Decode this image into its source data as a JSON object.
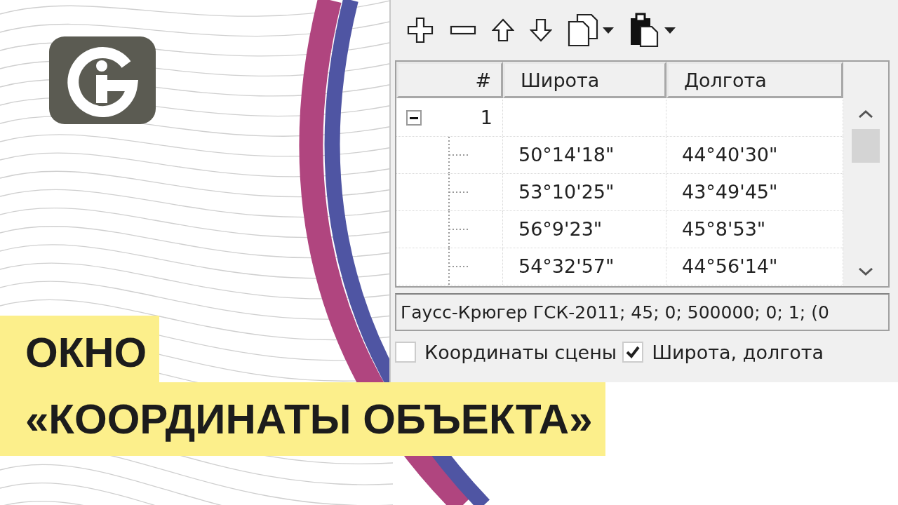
{
  "table": {
    "columns": [
      "#",
      "Широта",
      "Долгота"
    ],
    "rows": [
      {
        "number": "1",
        "expanded": true,
        "children": [
          {
            "latitude": "50°14'18\"",
            "longitude": "44°40'30\""
          },
          {
            "latitude": "53°10'25\"",
            "longitude": "43°49'45\""
          },
          {
            "latitude": "56°9'23\"",
            "longitude": "45°8'53\""
          },
          {
            "latitude": "54°32'57\"",
            "longitude": "44°56'14\""
          }
        ]
      }
    ]
  },
  "coordinate_system": {
    "value": "Гаусс-Крюгер ГСК-2011; 45; 0; 500000; 0; 1; (0"
  },
  "checkboxes": [
    {
      "label": "Координаты сцены",
      "checked": false
    },
    {
      "label": "Широта, долгота",
      "checked": true
    }
  ],
  "title": {
    "lines": [
      "ОКНО",
      "«КООРДИНАТЫ ОБЪЕКТА»"
    ]
  }
}
